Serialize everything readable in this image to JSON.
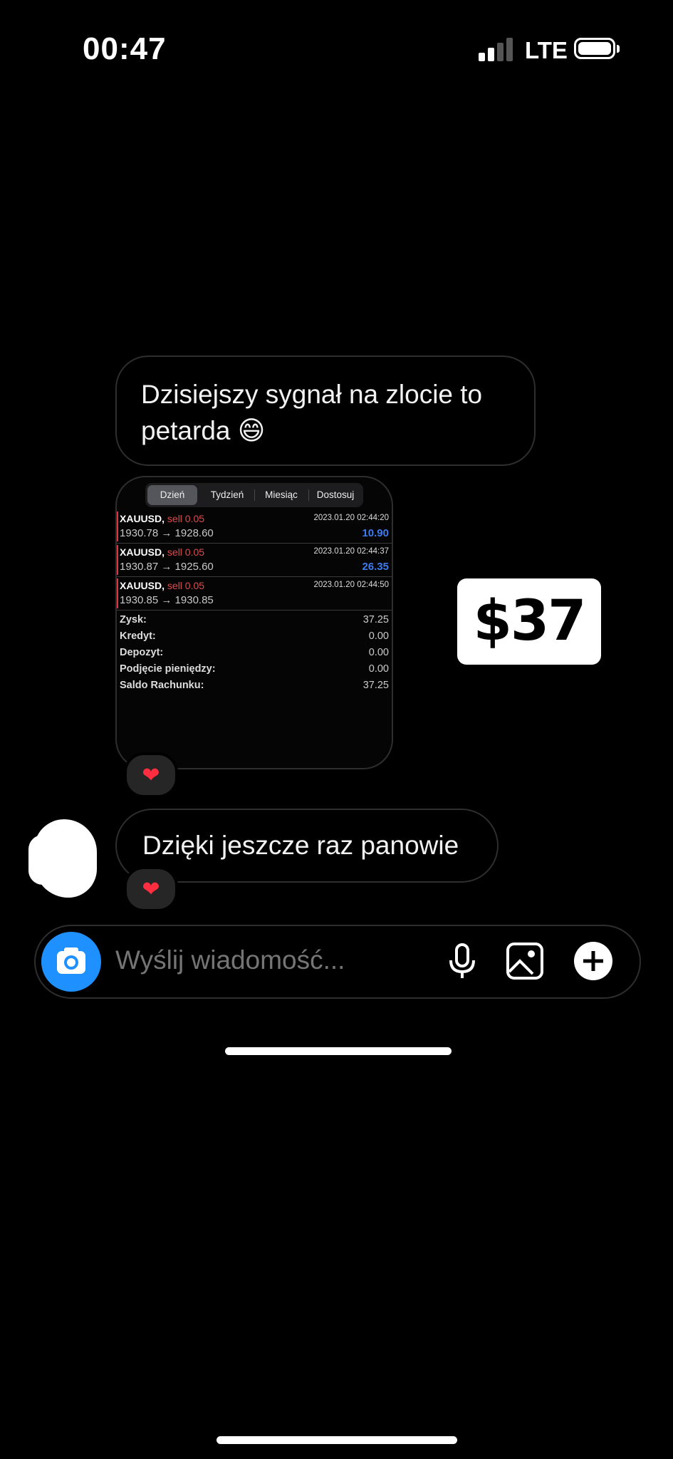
{
  "status": {
    "time": "00:47",
    "network": "LTE"
  },
  "messages": {
    "first": "Dzisiejszy sygnał na zlocie to petarda 😄",
    "second": "Dzięki jeszcze raz panowie",
    "reaction": "❤"
  },
  "screenshot": {
    "tabs": [
      "Dzień",
      "Tydzień",
      "Miesiąc",
      "Dostosuj"
    ],
    "trades": [
      {
        "symbol": "XAUUSD,",
        "side": "sell 0.05",
        "date": "2023.01.20 02:44:20",
        "prices": "1930.78 → 1928.60",
        "profit": "10.90"
      },
      {
        "symbol": "XAUUSD,",
        "side": "sell 0.05",
        "date": "2023.01.20 02:44:37",
        "prices": "1930.87 → 1925.60",
        "profit": "26.35"
      },
      {
        "symbol": "XAUUSD,",
        "side": "sell 0.05",
        "date": "2023.01.20 02:44:50",
        "prices": "1930.85 → 1930.85",
        "profit": ""
      }
    ],
    "summary": [
      {
        "label": "Zysk:",
        "value": "37.25"
      },
      {
        "label": "Kredyt:",
        "value": "0.00"
      },
      {
        "label": "Depozyt:",
        "value": "0.00"
      },
      {
        "label": "Podjęcie pieniędzy:",
        "value": "0.00"
      },
      {
        "label": "Saldo Rachunku:",
        "value": "37.25"
      }
    ]
  },
  "badge": "$37",
  "composer": {
    "placeholder": "Wyślij wiadomość..."
  },
  "colors": {
    "accent": "#1e90ff",
    "loss": "#e04b4b",
    "profit": "#3d7cf0"
  }
}
